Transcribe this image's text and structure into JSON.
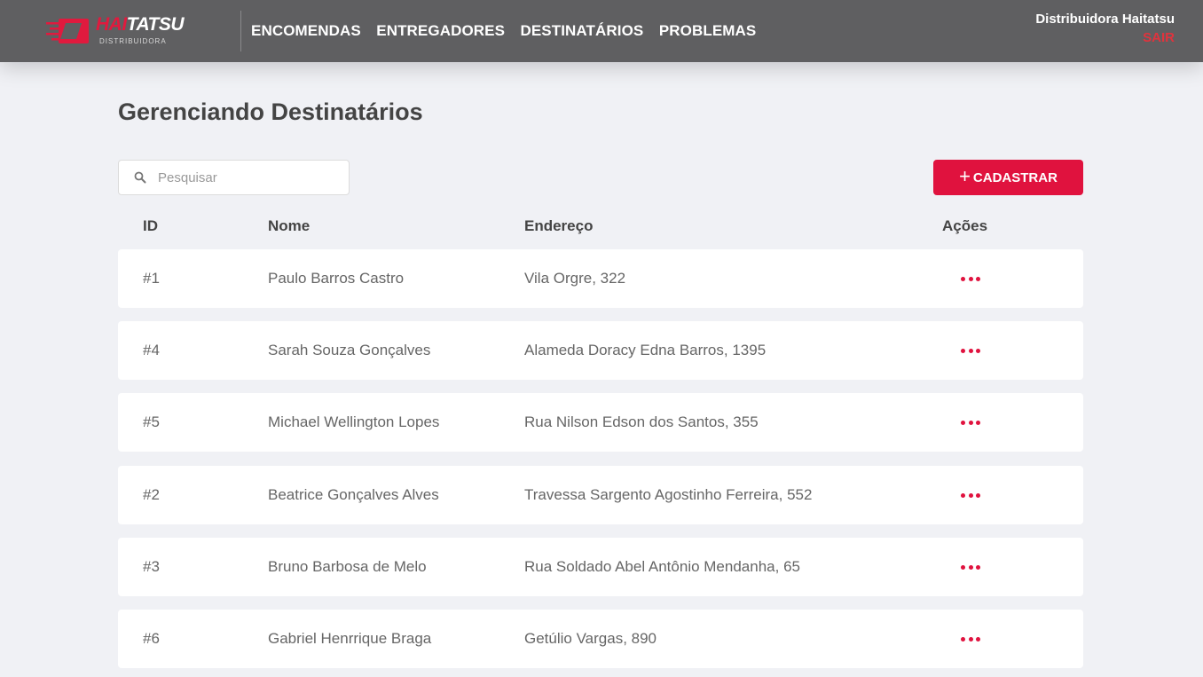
{
  "header": {
    "logo": {
      "word_red": "HAI",
      "word_white": "TATSU",
      "sub": "DISTRIBUIDORA"
    },
    "nav": [
      "ENCOMENDAS",
      "ENTREGADORES",
      "DESTINATÁRIOS",
      "PROBLEMAS"
    ],
    "user_name": "Distribuidora Haitatsu",
    "logout_label": "SAIR"
  },
  "page": {
    "title": "Gerenciando Destinatários",
    "search_placeholder": "Pesquisar",
    "add_button_label": "CADASTRAR"
  },
  "table": {
    "headers": {
      "id": "ID",
      "name": "Nome",
      "address": "Endereço",
      "actions": "Ações"
    },
    "rows": [
      {
        "id": "#1",
        "name": "Paulo Barros Castro",
        "address": "Vila Orgre, 322"
      },
      {
        "id": "#4",
        "name": "Sarah Souza Gonçalves",
        "address": "Alameda Doracy Edna Barros, 1395"
      },
      {
        "id": "#5",
        "name": "Michael Wellington Lopes",
        "address": "Rua Nilson Edson dos Santos, 355"
      },
      {
        "id": "#2",
        "name": "Beatrice Gonçalves Alves",
        "address": "Travessa Sargento Agostinho Ferreira, 552"
      },
      {
        "id": "#3",
        "name": "Bruno Barbosa de Melo",
        "address": "Rua Soldado Abel Antônio Mendanha, 65"
      },
      {
        "id": "#6",
        "name": "Gabriel Henrrique Braga",
        "address": "Getúlio Vargas, 890"
      }
    ]
  },
  "colors": {
    "header_bg": "#5f5f61",
    "accent": "#e0123e",
    "page_bg": "#f0f1f5"
  },
  "icons": {
    "search": "search-icon",
    "add": "plus-icon",
    "row_actions": "more-horizontal-icon"
  }
}
